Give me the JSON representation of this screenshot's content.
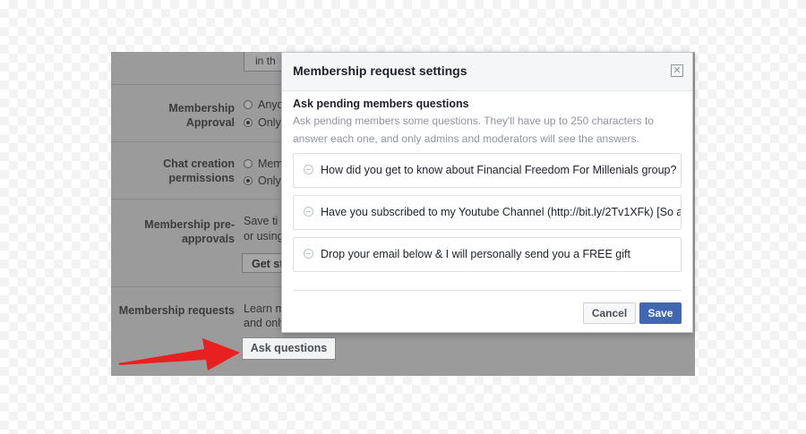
{
  "settings_page": {
    "top_text": "in th",
    "rows": [
      {
        "label": "Membership Approval",
        "options": [
          "Anyo",
          "Only"
        ],
        "selected": 1
      },
      {
        "label": "Chat creation permissions",
        "options": [
          "Mem",
          "Only"
        ],
        "selected": 1
      },
      {
        "label": "Membership pre-approvals",
        "text_lines": [
          "Save ti",
          "or using"
        ],
        "button": "Get st"
      },
      {
        "label": "Membership requests",
        "text_lines": [
          "Learn m",
          "and only"
        ],
        "button": "Ask questions"
      }
    ]
  },
  "modal": {
    "title": "Membership request settings",
    "close_glyph": "✕",
    "section_title": "Ask pending members questions",
    "section_desc": "Ask pending members some questions. They'll have up to 250 characters to answer each one, and only admins and moderators will see the answers.",
    "questions": [
      "How did you get to know about Financial Freedom For Millenials group?",
      "Have you subscribed to my Youtube Channel (http://bit.ly/2Tv1XFk) [So a",
      "Drop your email below & I will personally send you a FREE gift"
    ],
    "cancel_label": "Cancel",
    "save_label": "Save"
  },
  "colors": {
    "accent": "#4267b2",
    "arrow": "#e8201f",
    "dim_overlay": "#9b9b9b"
  }
}
